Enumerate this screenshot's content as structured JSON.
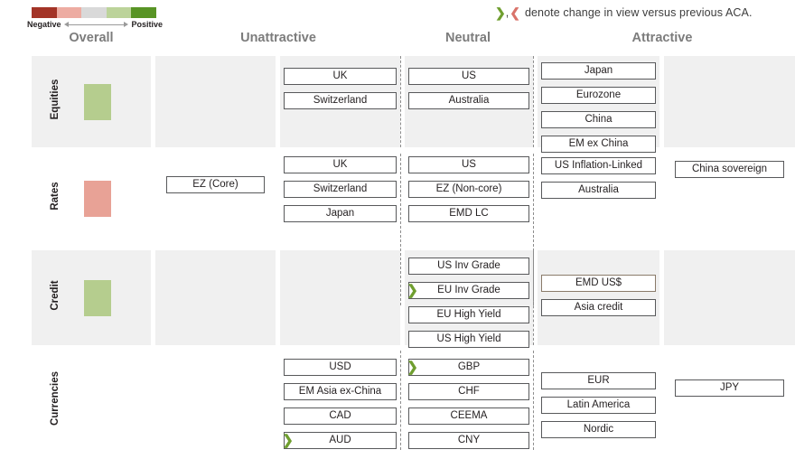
{
  "legend": {
    "negative_label": "Negative",
    "positive_label": "Positive",
    "gradient": [
      "#a33427",
      "#edaca2",
      "#d9d9d9",
      "#bcd39a",
      "#589425"
    ],
    "change_note": {
      "increase_glyph": "❯",
      "decrease_glyph": "❮",
      "separator": ",",
      "text": "denote change in view versus previous ACA."
    }
  },
  "columns": [
    {
      "key": "overall",
      "label": "Overall"
    },
    {
      "key": "unattractive",
      "label": "Unattractive"
    },
    {
      "key": "neutral",
      "label": "Neutral"
    },
    {
      "key": "attractive",
      "label": "Attractive"
    }
  ],
  "colors": {
    "positive_swatch": "#b5cd8e",
    "negative_swatch": "#e8a296",
    "band": "#f0f0f0",
    "chip_border": "#58595b",
    "marker_up": "#6f9e2f",
    "marker_down": "#d9736a",
    "header_text": "#7c7c7c"
  },
  "rows": [
    {
      "key": "equities",
      "label": "Equities",
      "overall": "positive",
      "banded": true,
      "items": {
        "very_unattractive": [],
        "unattractive": [
          {
            "label": "UK",
            "change": null
          },
          {
            "label": "Switzerland",
            "change": null
          }
        ],
        "neutral": [
          {
            "label": "US",
            "change": null
          },
          {
            "label": "Australia",
            "change": null
          }
        ],
        "attractive": [
          {
            "label": "Japan",
            "change": null
          },
          {
            "label": "Eurozone",
            "change": null
          },
          {
            "label": "China",
            "change": null
          },
          {
            "label": "EM ex China",
            "change": null
          }
        ],
        "very_attractive": []
      }
    },
    {
      "key": "rates",
      "label": "Rates",
      "overall": "negative",
      "banded": false,
      "items": {
        "very_unattractive": [
          {
            "label": "EZ (Core)",
            "change": null
          }
        ],
        "unattractive": [
          {
            "label": "UK",
            "change": null
          },
          {
            "label": "Switzerland",
            "change": null
          },
          {
            "label": "Japan",
            "change": null
          }
        ],
        "neutral": [
          {
            "label": "US",
            "change": null
          },
          {
            "label": "EZ (Non-core)",
            "change": null
          },
          {
            "label": "EMD LC",
            "change": null
          }
        ],
        "attractive": [
          {
            "label": "US Inflation-Linked",
            "change": null
          },
          {
            "label": "Australia",
            "change": null
          }
        ],
        "very_attractive": [
          {
            "label": "China sovereign",
            "change": null
          }
        ]
      }
    },
    {
      "key": "credit",
      "label": "Credit",
      "overall": "positive",
      "banded": true,
      "items": {
        "very_unattractive": [],
        "unattractive": [],
        "neutral": [
          {
            "label": "US Inv Grade",
            "change": null
          },
          {
            "label": "EU Inv Grade",
            "change": "up"
          },
          {
            "label": "EU High Yield",
            "change": null
          },
          {
            "label": "US High Yield",
            "change": null
          }
        ],
        "attractive": [
          {
            "label": "EMD US$",
            "change": null,
            "border": "brown"
          },
          {
            "label": "Asia credit",
            "change": null
          }
        ],
        "very_attractive": []
      }
    },
    {
      "key": "currencies",
      "label": "Currencies",
      "overall": null,
      "banded": false,
      "items": {
        "very_unattractive": [],
        "unattractive": [
          {
            "label": "USD",
            "change": null
          },
          {
            "label": "EM Asia ex-China",
            "change": null
          },
          {
            "label": "CAD",
            "change": null
          },
          {
            "label": "AUD",
            "change": "up"
          }
        ],
        "neutral": [
          {
            "label": "GBP",
            "change": "up"
          },
          {
            "label": "CHF",
            "change": null
          },
          {
            "label": "CEEMA",
            "change": null
          },
          {
            "label": "CNY",
            "change": null
          }
        ],
        "attractive": [
          {
            "label": "EUR",
            "change": null
          },
          {
            "label": "Latin America",
            "change": null
          },
          {
            "label": "Nordic",
            "change": null
          }
        ],
        "very_attractive": [
          {
            "label": "JPY",
            "change": null
          }
        ]
      }
    }
  ]
}
